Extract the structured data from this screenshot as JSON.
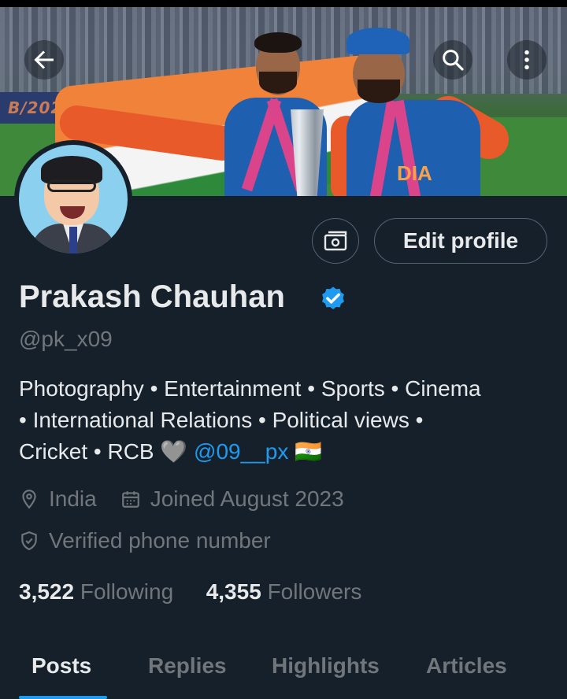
{
  "header": {
    "back_icon": "arrow-left-icon",
    "search_icon": "search-icon",
    "more_icon": "more-vertical-icon",
    "banner_board_text": "B/2024",
    "banner_jersey_text": "DIA"
  },
  "profile": {
    "name": "Prakash Chauhan",
    "handle": "@pk_x09",
    "verified": true,
    "verified_color": "#1d9bf0",
    "edit_button_label": "Edit profile",
    "bio": {
      "line1": "Photography • Entertainment • Sports  • Cinema",
      "line2": "• International Relations • Political views •",
      "line3_text": "Cricket •  RCB 🩶",
      "line3_mention": "@09__px",
      "line3_flag": "🇮🇳"
    },
    "location": "India",
    "joined": "Joined August 2023",
    "verified_phone": "Verified phone number",
    "following_count": "3,522",
    "following_label": "Following",
    "followers_count": "4,355",
    "followers_label": "Followers"
  },
  "tabs": [
    {
      "label": "Posts",
      "active": true
    },
    {
      "label": "Replies",
      "active": false
    },
    {
      "label": "Highlights",
      "active": false
    },
    {
      "label": "Articles",
      "active": false
    }
  ],
  "colors": {
    "background": "#15202b",
    "text_primary": "#e7e9ea",
    "text_secondary": "#71767b",
    "accent": "#1d9bf0",
    "border": "#536471"
  }
}
